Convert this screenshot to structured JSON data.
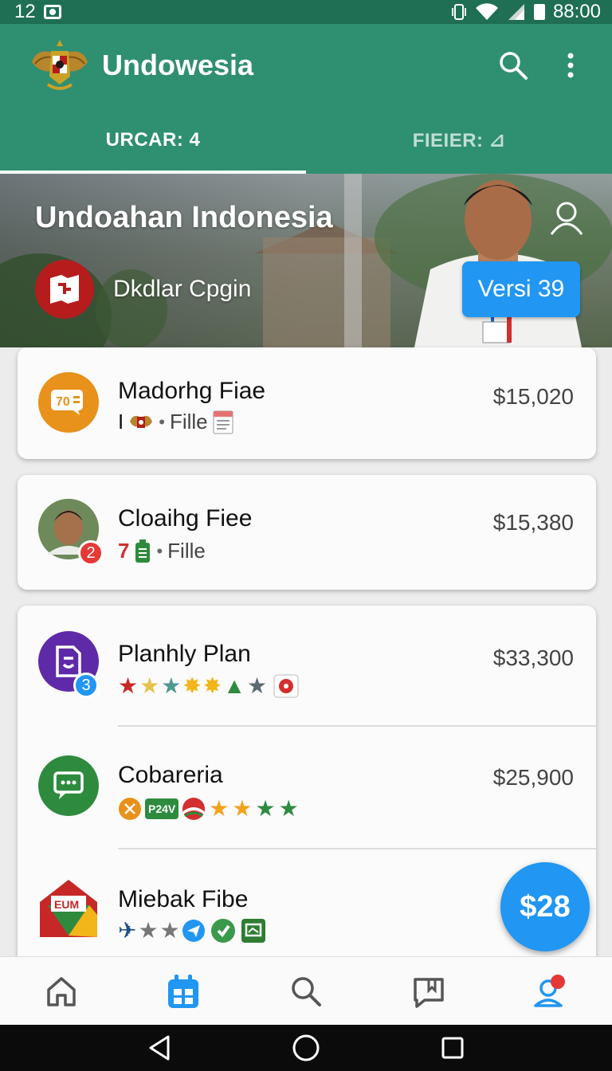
{
  "status_bar": {
    "time": "12",
    "clock": "88:00"
  },
  "app": {
    "title": "Undowesia"
  },
  "tabs": [
    {
      "label": "URCAR: 4",
      "active": true
    },
    {
      "label": "FIEIER: ⊿",
      "active": false
    }
  ],
  "hero": {
    "title": "Undoahan Indonesia",
    "subtitle": "Dkdlar Cpgin",
    "version_label": "Versi 39"
  },
  "items": [
    {
      "title": "Madorhg Fiae",
      "meta_label": "Fille",
      "price": "$15,020",
      "icon": "chat-bubble-icon",
      "icon_color": "#e8911b"
    },
    {
      "title": "Cloaihg Fiee",
      "meta_prefix": "7",
      "meta_label": "Fille",
      "price": "$15,380",
      "icon": "avatar",
      "badge": "2",
      "badge_color": "#e53935"
    },
    {
      "title": "Planhly Plan",
      "price": "$33,300",
      "icon": "document-icon",
      "icon_color": "#5e2aa8",
      "badge": "3",
      "badge_color": "#2196f3"
    },
    {
      "title": "Cobareria",
      "price": "$25,900",
      "icon": "message-icon",
      "icon_color": "#2e8b3e",
      "sticker": "P24V"
    },
    {
      "title": "Miebak Fibe",
      "price": "$",
      "icon": "home-badge-icon",
      "sticker": "EUM"
    }
  ],
  "fab": {
    "label": "$28"
  },
  "bottom_nav": [
    {
      "name": "home-icon"
    },
    {
      "name": "calendar-icon",
      "active": true
    },
    {
      "name": "search-icon"
    },
    {
      "name": "book-icon"
    },
    {
      "name": "profile-icon"
    }
  ],
  "colors": {
    "primary": "#2f8f71",
    "status_bar": "#1e6f54",
    "accent": "#2196f3"
  }
}
